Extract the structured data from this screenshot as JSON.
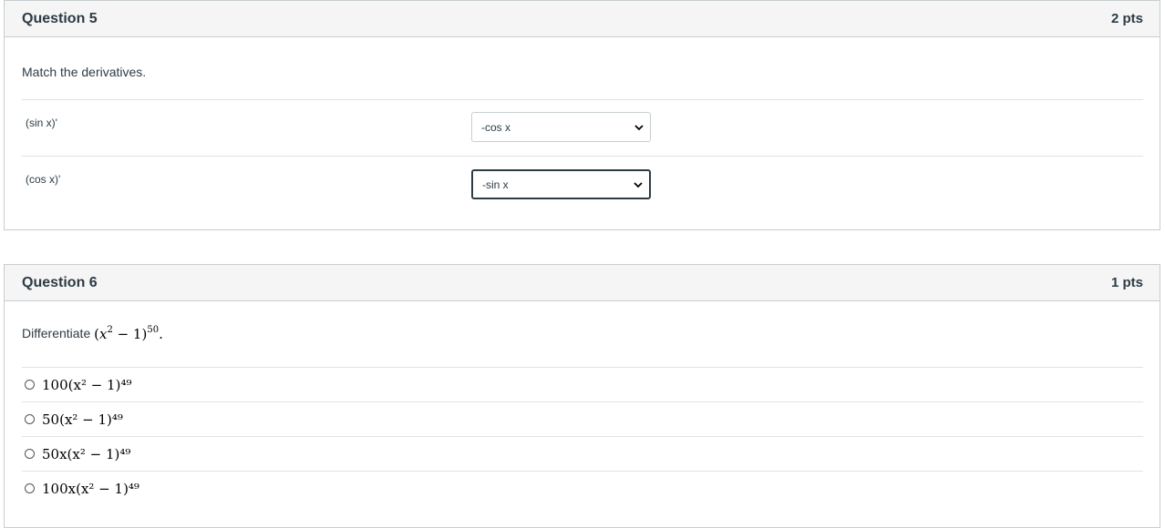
{
  "q5": {
    "title": "Question 5",
    "points": "2 pts",
    "prompt": "Match the derivatives.",
    "rows": [
      {
        "label": "(sin x)'",
        "selected": "-cos x"
      },
      {
        "label": "(cos x)'",
        "selected": "-sin x"
      }
    ]
  },
  "q6": {
    "title": "Question 6",
    "points": "1 pts",
    "prompt_prefix": "Differentiate",
    "answers": [
      "100(x² − 1)⁴⁹",
      "50(x² − 1)⁴⁹",
      "50x(x² − 1)⁴⁹",
      "100x(x² − 1)⁴⁹"
    ]
  }
}
